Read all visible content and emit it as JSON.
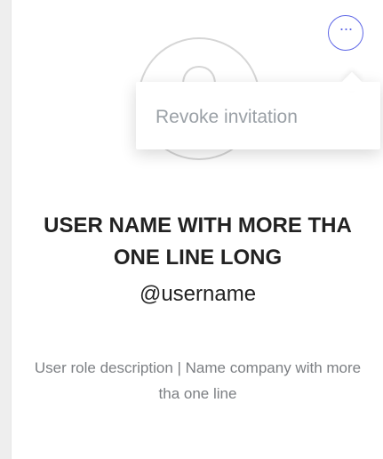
{
  "menu": {
    "trigger_icon": "more-horizontal-icon",
    "items": [
      {
        "label": "Revoke invitation"
      }
    ]
  },
  "profile": {
    "avatar_icon": "user-avatar-placeholder-icon",
    "name": "USER NAME WITH MORE THA ONE LINE LONG",
    "username": "@username",
    "description": "User role description | Name company with more tha one line"
  },
  "colors": {
    "accent": "#5d66e6",
    "text_primary": "#222222",
    "text_secondary": "#7c7f83",
    "menu_text": "#9aa0a6",
    "avatar_stroke": "#d6d6d6"
  }
}
